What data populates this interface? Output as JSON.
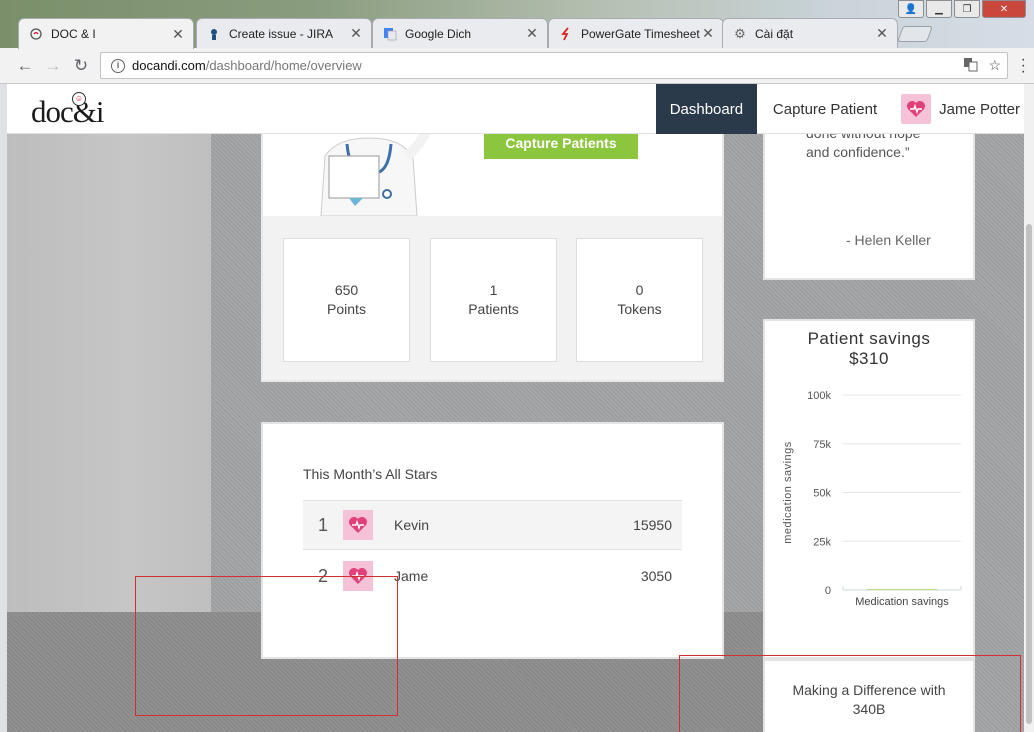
{
  "browser": {
    "tabs": [
      {
        "title": "DOC & I",
        "icon": "docandi-favicon",
        "active": true
      },
      {
        "title": "Create issue - JIRA",
        "icon": "jira-favicon",
        "active": false
      },
      {
        "title": "Google Dich",
        "icon": "google-translate-favicon",
        "active": false
      },
      {
        "title": "PowerGate Timesheet",
        "icon": "powergate-favicon",
        "active": false
      },
      {
        "title": "Cài đặt",
        "icon": "gear-icon",
        "active": false
      }
    ],
    "url_domain": "docandi.com",
    "url_path": "/dashboard/home/overview"
  },
  "header": {
    "logo_text": "doc&i",
    "nav_dashboard": "Dashboard",
    "nav_capture": "Capture Patient",
    "user_name": "Jame Potter"
  },
  "hero": {
    "capture_button": "Capture Patients",
    "stats": [
      {
        "value": "650",
        "label": "Points"
      },
      {
        "value": "1",
        "label": "Patients"
      },
      {
        "value": "0",
        "label": "Tokens"
      }
    ]
  },
  "all_stars": {
    "title": "This Month’s All Stars",
    "rows": [
      {
        "rank": "1",
        "name": "Kevin",
        "score": "15950"
      },
      {
        "rank": "2",
        "name": "Jame",
        "score": "3050"
      }
    ]
  },
  "quote": {
    "line1": "done without hope",
    "line2": "and confidence.”",
    "author": "- Helen Keller"
  },
  "savings": {
    "title": "Patient savings",
    "amount": "$310"
  },
  "chart_data": {
    "type": "bar",
    "title": "",
    "categories": [
      "Medication savings"
    ],
    "values": [
      310
    ],
    "ylabel": "medication savings",
    "xlabel": "",
    "yticks": [
      "0",
      "25k",
      "50k",
      "75k",
      "100k"
    ],
    "ylim": [
      0,
      100000
    ],
    "grid": true
  },
  "making": {
    "line1": "Making a Difference with",
    "line2": "340B"
  },
  "colors": {
    "nav_active": "#2b3a4a",
    "capture_green": "#8cc63f",
    "avatar_pink": "#f5c2d8",
    "heart": "#e0417a"
  }
}
